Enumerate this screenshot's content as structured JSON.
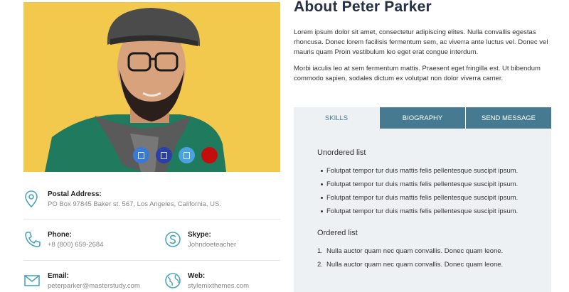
{
  "profile": {
    "title": "About Peter Parker",
    "paragraphs": [
      "Lorem ipsum dolor sit amet, consectetur adipiscing elites. Nulla convallis egestas rhoncusa. Donec lorem facilisis fermentum sem, ac viverra ante luctus vel. Donec vel mauris quam Proin vestibulum leo eget erat congue interdum.",
      "Morbi iaculis leo at sem fermentum mattis. Praesent eget fringilla est. Ut bibendum commodo sapien, sodales dictum ex volutpat non dolor viverra camer."
    ]
  },
  "photo": {
    "background_color": "#f2c94c",
    "social_icons": [
      "facebook-icon",
      "linkedin-icon",
      "twitter-icon",
      "google-plus-icon"
    ]
  },
  "contact": {
    "postal": {
      "label": "Postal Address:",
      "value": "PO Box 97845 Baker st. 567, Los Angeles, California, US."
    },
    "phone": {
      "label": "Phone:",
      "value": "+8 (800) 659-2684"
    },
    "skype": {
      "label": "Skype:",
      "value": "Johndoeteacher"
    },
    "email": {
      "label": "Email:",
      "value": "peterparker@masterstudy.com"
    },
    "web": {
      "label": "Web:",
      "value": "stylemixthemes.com"
    }
  },
  "tabs": [
    {
      "label": "SKILLS",
      "active": true
    },
    {
      "label": "BIOGRAPHY",
      "active": false
    },
    {
      "label": "SEND MESSAGE",
      "active": false
    }
  ],
  "skills": {
    "unordered_heading": "Unordered list",
    "unordered_items": [
      "Folutpat tempor tur duis mattis felis pellentesque suscipit ipsum.",
      "Folutpat tempor tur duis mattis felis pellentesque suscipit ipsum.",
      "Folutpat tempor tur duis mattis felis pellentesque suscipit ipsum.",
      "Folutpat tempor tur duis mattis felis pellentesque suscipit ipsum."
    ],
    "ordered_heading": "Ordered list",
    "ordered_items": [
      {
        "num": "1.",
        "text": "Nulla auctor quam nec quam convallis. Donec quam leone."
      },
      {
        "num": "2.",
        "text": "Nulla auctor quam nec quam convallis. Donec quam leone."
      }
    ]
  },
  "colors": {
    "accent": "#457a91",
    "title": "#273044",
    "panel_bg": "#eef1f4",
    "icon": "#4aa3c4"
  }
}
